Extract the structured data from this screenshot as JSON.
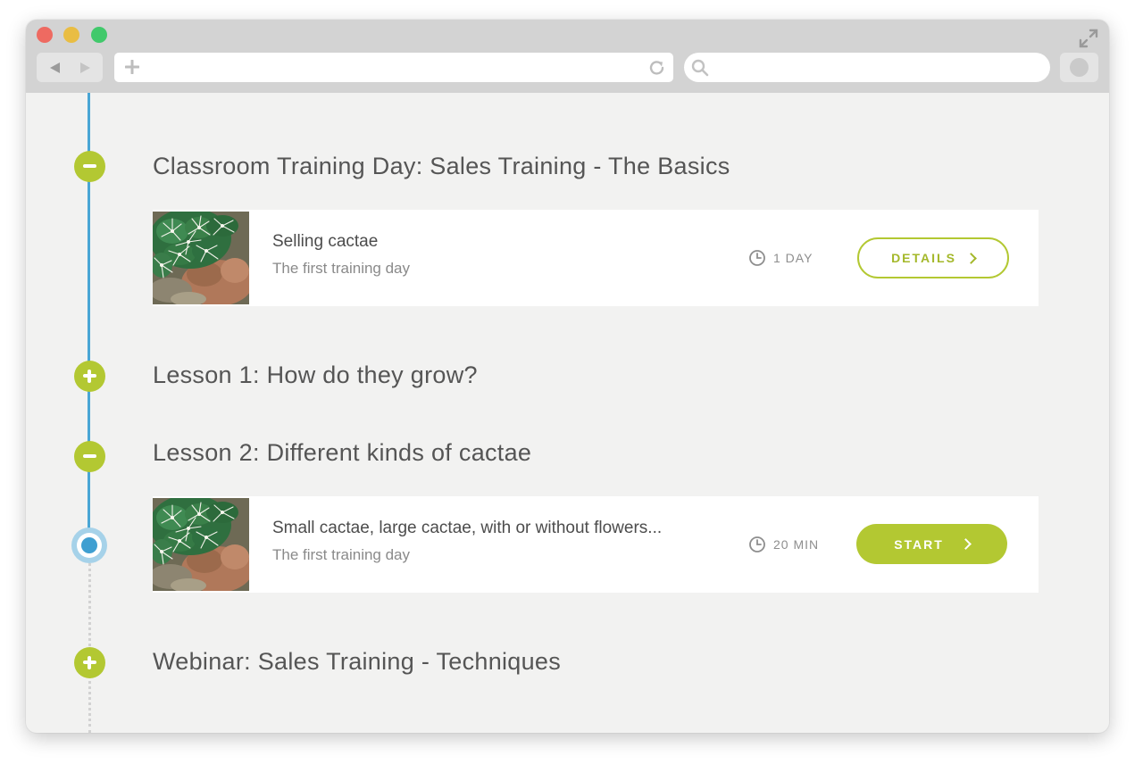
{
  "browser": {
    "window_controls": [
      "close",
      "minimize",
      "maximize"
    ],
    "icons": {
      "back": "back-arrow-icon",
      "forward": "forward-arrow-icon",
      "new_tab": "plus-icon",
      "reload": "reload-icon",
      "search": "search-icon",
      "expand": "expand-icon"
    },
    "url": "",
    "search_query": ""
  },
  "colors": {
    "accent_green": "#b3c832",
    "timeline_blue": "#4aa6d5",
    "current_blue": "#3f9fd1",
    "background": "#f2f2f1"
  },
  "timeline": {
    "sections": [
      {
        "title": "Classroom Training Day: Sales Training - The Basics",
        "state": "expanded",
        "toggle_icon": "minus-icon",
        "items": [
          {
            "title": "Selling cactae",
            "subtitle": "The first training day",
            "duration": "1 DAY",
            "duration_icon": "clock-icon",
            "action": "DETAILS",
            "action_style": "outline",
            "thumbnail": "cactus-image"
          }
        ]
      },
      {
        "title": "Lesson 1: How do they grow?",
        "state": "collapsed",
        "toggle_icon": "plus-icon",
        "items": []
      },
      {
        "title": "Lesson 2: Different kinds of cactae",
        "state": "expanded",
        "toggle_icon": "minus-icon",
        "items": [
          {
            "title": "Small cactae, large cactae, with or without flowers...",
            "subtitle": "The first training day",
            "duration": "20 MIN",
            "duration_icon": "clock-icon",
            "action": "START",
            "action_style": "filled",
            "thumbnail": "cactus-image",
            "current": true
          }
        ]
      },
      {
        "title": "Webinar: Sales Training - Techniques",
        "state": "collapsed",
        "toggle_icon": "plus-icon",
        "items": []
      }
    ]
  }
}
